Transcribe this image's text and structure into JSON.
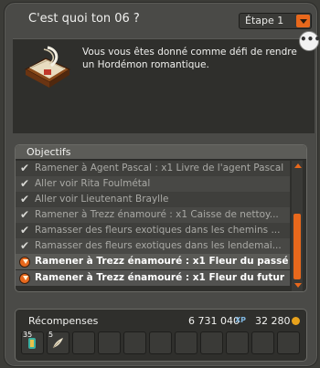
{
  "window": {
    "title": "C'est quoi ton 06 ?",
    "step_select": "Étape 1",
    "more_button": "•••"
  },
  "description": {
    "text": "Vous vous êtes donné comme défi de rendre un Hordémon romantique."
  },
  "objectives": {
    "header": "Objectifs",
    "items": [
      {
        "text": "Ramener à Agent Pascal : x1 Livre de l'agent Pascal",
        "status": "done"
      },
      {
        "text": "Aller voir Rita Foulmétal",
        "status": "done"
      },
      {
        "text": "Aller voir Lieutenant Braylle",
        "status": "done"
      },
      {
        "text": "Ramener à Trezz énamouré : x1 Caisse de nettoy...",
        "status": "done"
      },
      {
        "text": "Ramasser des fleurs exotiques dans les chemins ...",
        "status": "done"
      },
      {
        "text": "Ramasser des fleurs exotiques dans les lendemai...",
        "status": "done"
      },
      {
        "text": "Ramener à Trezz énamouré : x1 Fleur du passé",
        "status": "active"
      },
      {
        "text": "Ramener à Trezz énamouré : x1 Fleur du futur",
        "status": "active"
      }
    ]
  },
  "rewards": {
    "title": "Récompenses",
    "xp": "6 731 040",
    "xp_unit": "XP",
    "kamas": "32 280",
    "items": [
      {
        "qty": "35",
        "icon": "scroll-icon"
      },
      {
        "qty": "5",
        "icon": "feather-icon"
      }
    ]
  },
  "colors": {
    "accent": "#e8681c",
    "panel_bg": "#2f2f2c",
    "window_bg": "#4a4a47"
  }
}
